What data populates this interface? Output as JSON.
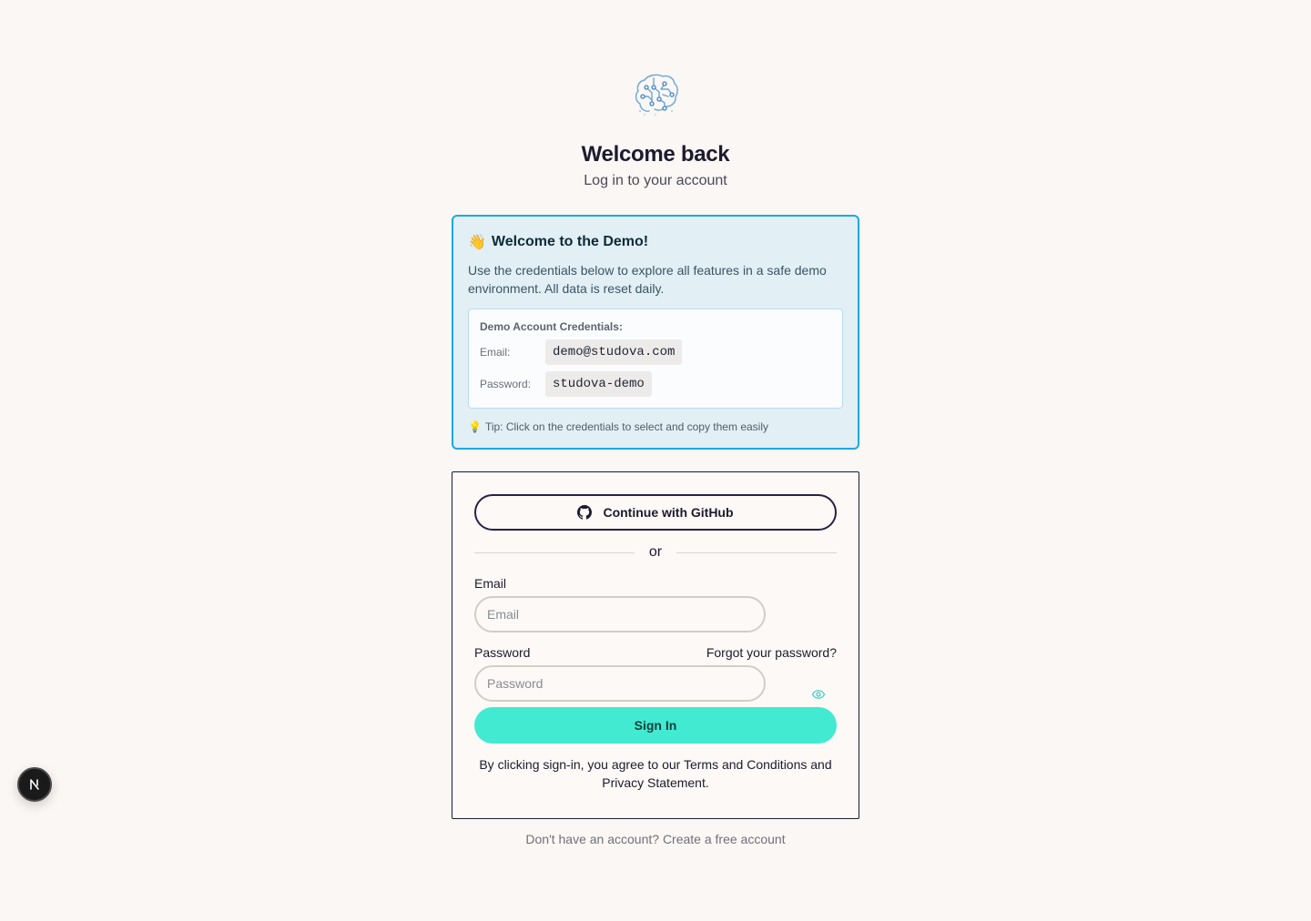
{
  "header": {
    "logo_icon": "brain-circuit-icon",
    "title": "Welcome back",
    "subtitle": "Log in to your account"
  },
  "demo": {
    "emoji": "👋",
    "heading": "Welcome to the Demo!",
    "description": "Use the credentials below to explore all features in a safe demo environment. All data is reset daily.",
    "credentials_title": "Demo Account Credentials:",
    "email_label": "Email:",
    "email_value": "demo@studova.com",
    "password_label": "Password:",
    "password_value": "studova-demo",
    "tip_emoji": "💡",
    "tip": "Tip: Click on the credentials to select and copy them easily"
  },
  "form": {
    "github_label": "Continue with GitHub",
    "divider_text": "or",
    "email_label": "Email",
    "email_placeholder": "Email",
    "email_value": "",
    "password_label": "Password",
    "password_placeholder": "Password",
    "password_value": "",
    "forgot_label": "Forgot your password?",
    "signin_label": "Sign In",
    "terms": "By clicking sign-in, you agree to our Terms and Conditions and Privacy Statement."
  },
  "footer": {
    "signup": "Don't have an account? Create a free account"
  },
  "dev_badge": {
    "letter": "N"
  },
  "colors": {
    "accent": "#42ead1",
    "demo_border": "#1ea7e8",
    "demo_bg": "#e2eff4",
    "page_bg": "#faf7f4"
  }
}
